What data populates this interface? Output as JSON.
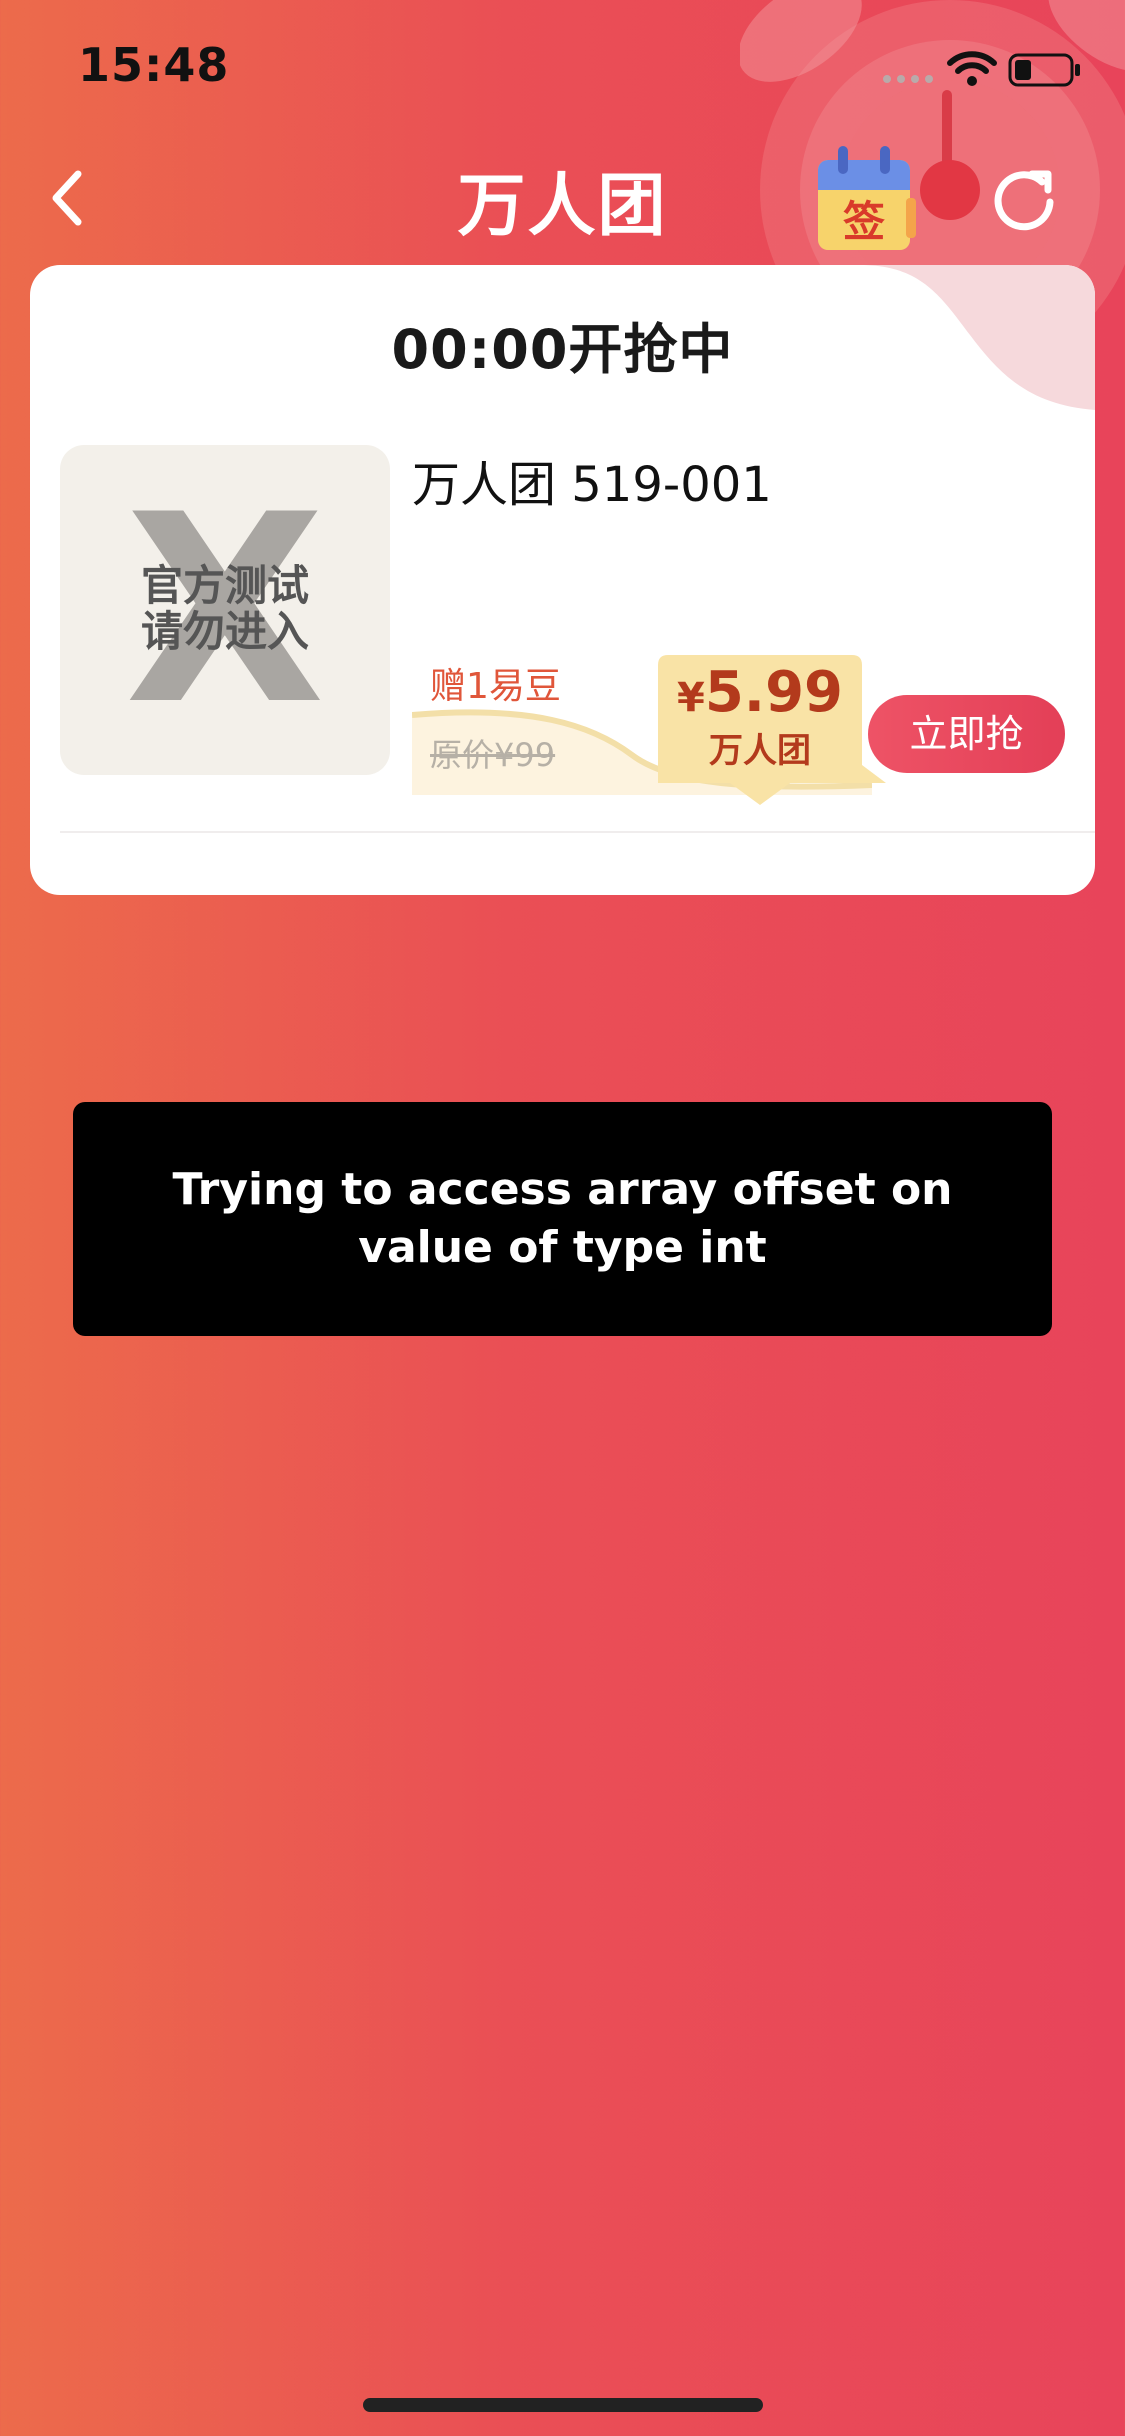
{
  "status_bar": {
    "time": "15:48",
    "icons": [
      "signal-dots-icon",
      "wifi-icon",
      "battery-icon"
    ],
    "battery_level": 0.3
  },
  "nav": {
    "title": "万人团",
    "back_icon": "chevron-left-icon",
    "signin_badge": "签",
    "refresh_icon": "refresh-icon"
  },
  "card": {
    "heading": "00:00开抢中",
    "product": {
      "image_text": "官方测试\n请勿进入",
      "image_glyph": "X",
      "name": "万人团 519-001",
      "bonus": "赠1易豆",
      "original_price": "原价¥99",
      "price_symbol": "¥",
      "price": "5.99",
      "price_label": "万人团",
      "buy_label": "立即抢"
    }
  },
  "toast": {
    "message": "Trying to access array offset on value of type int"
  },
  "colors": {
    "background_start": "#ec6b4b",
    "background_end": "#e8445a",
    "accent": "#e33f57",
    "price_text": "#b33a1c",
    "bonus_text": "#e0563a"
  }
}
